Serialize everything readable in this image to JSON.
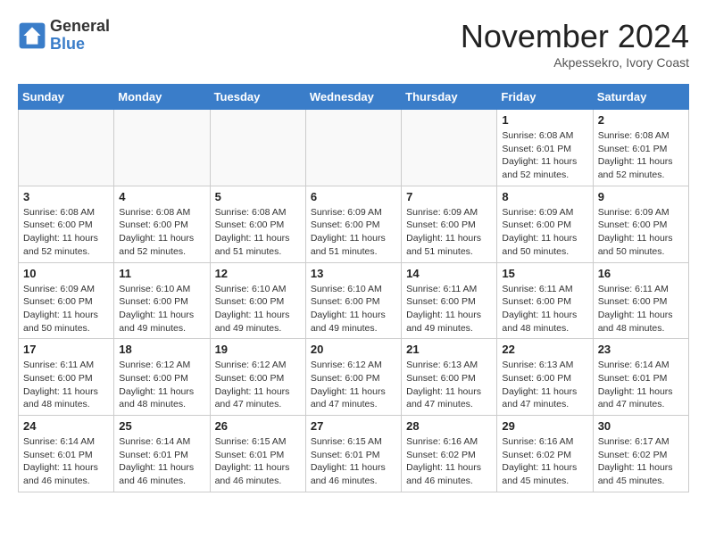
{
  "header": {
    "logo_general": "General",
    "logo_blue": "Blue",
    "month_title": "November 2024",
    "subtitle": "Akpessekro, Ivory Coast"
  },
  "days_of_week": [
    "Sunday",
    "Monday",
    "Tuesday",
    "Wednesday",
    "Thursday",
    "Friday",
    "Saturday"
  ],
  "weeks": [
    [
      {
        "day": "",
        "info": ""
      },
      {
        "day": "",
        "info": ""
      },
      {
        "day": "",
        "info": ""
      },
      {
        "day": "",
        "info": ""
      },
      {
        "day": "",
        "info": ""
      },
      {
        "day": "1",
        "info": "Sunrise: 6:08 AM\nSunset: 6:01 PM\nDaylight: 11 hours and 52 minutes."
      },
      {
        "day": "2",
        "info": "Sunrise: 6:08 AM\nSunset: 6:01 PM\nDaylight: 11 hours and 52 minutes."
      }
    ],
    [
      {
        "day": "3",
        "info": "Sunrise: 6:08 AM\nSunset: 6:00 PM\nDaylight: 11 hours and 52 minutes."
      },
      {
        "day": "4",
        "info": "Sunrise: 6:08 AM\nSunset: 6:00 PM\nDaylight: 11 hours and 52 minutes."
      },
      {
        "day": "5",
        "info": "Sunrise: 6:08 AM\nSunset: 6:00 PM\nDaylight: 11 hours and 51 minutes."
      },
      {
        "day": "6",
        "info": "Sunrise: 6:09 AM\nSunset: 6:00 PM\nDaylight: 11 hours and 51 minutes."
      },
      {
        "day": "7",
        "info": "Sunrise: 6:09 AM\nSunset: 6:00 PM\nDaylight: 11 hours and 51 minutes."
      },
      {
        "day": "8",
        "info": "Sunrise: 6:09 AM\nSunset: 6:00 PM\nDaylight: 11 hours and 50 minutes."
      },
      {
        "day": "9",
        "info": "Sunrise: 6:09 AM\nSunset: 6:00 PM\nDaylight: 11 hours and 50 minutes."
      }
    ],
    [
      {
        "day": "10",
        "info": "Sunrise: 6:09 AM\nSunset: 6:00 PM\nDaylight: 11 hours and 50 minutes."
      },
      {
        "day": "11",
        "info": "Sunrise: 6:10 AM\nSunset: 6:00 PM\nDaylight: 11 hours and 49 minutes."
      },
      {
        "day": "12",
        "info": "Sunrise: 6:10 AM\nSunset: 6:00 PM\nDaylight: 11 hours and 49 minutes."
      },
      {
        "day": "13",
        "info": "Sunrise: 6:10 AM\nSunset: 6:00 PM\nDaylight: 11 hours and 49 minutes."
      },
      {
        "day": "14",
        "info": "Sunrise: 6:11 AM\nSunset: 6:00 PM\nDaylight: 11 hours and 49 minutes."
      },
      {
        "day": "15",
        "info": "Sunrise: 6:11 AM\nSunset: 6:00 PM\nDaylight: 11 hours and 48 minutes."
      },
      {
        "day": "16",
        "info": "Sunrise: 6:11 AM\nSunset: 6:00 PM\nDaylight: 11 hours and 48 minutes."
      }
    ],
    [
      {
        "day": "17",
        "info": "Sunrise: 6:11 AM\nSunset: 6:00 PM\nDaylight: 11 hours and 48 minutes."
      },
      {
        "day": "18",
        "info": "Sunrise: 6:12 AM\nSunset: 6:00 PM\nDaylight: 11 hours and 48 minutes."
      },
      {
        "day": "19",
        "info": "Sunrise: 6:12 AM\nSunset: 6:00 PM\nDaylight: 11 hours and 47 minutes."
      },
      {
        "day": "20",
        "info": "Sunrise: 6:12 AM\nSunset: 6:00 PM\nDaylight: 11 hours and 47 minutes."
      },
      {
        "day": "21",
        "info": "Sunrise: 6:13 AM\nSunset: 6:00 PM\nDaylight: 11 hours and 47 minutes."
      },
      {
        "day": "22",
        "info": "Sunrise: 6:13 AM\nSunset: 6:00 PM\nDaylight: 11 hours and 47 minutes."
      },
      {
        "day": "23",
        "info": "Sunrise: 6:14 AM\nSunset: 6:01 PM\nDaylight: 11 hours and 47 minutes."
      }
    ],
    [
      {
        "day": "24",
        "info": "Sunrise: 6:14 AM\nSunset: 6:01 PM\nDaylight: 11 hours and 46 minutes."
      },
      {
        "day": "25",
        "info": "Sunrise: 6:14 AM\nSunset: 6:01 PM\nDaylight: 11 hours and 46 minutes."
      },
      {
        "day": "26",
        "info": "Sunrise: 6:15 AM\nSunset: 6:01 PM\nDaylight: 11 hours and 46 minutes."
      },
      {
        "day": "27",
        "info": "Sunrise: 6:15 AM\nSunset: 6:01 PM\nDaylight: 11 hours and 46 minutes."
      },
      {
        "day": "28",
        "info": "Sunrise: 6:16 AM\nSunset: 6:02 PM\nDaylight: 11 hours and 46 minutes."
      },
      {
        "day": "29",
        "info": "Sunrise: 6:16 AM\nSunset: 6:02 PM\nDaylight: 11 hours and 45 minutes."
      },
      {
        "day": "30",
        "info": "Sunrise: 6:17 AM\nSunset: 6:02 PM\nDaylight: 11 hours and 45 minutes."
      }
    ]
  ]
}
